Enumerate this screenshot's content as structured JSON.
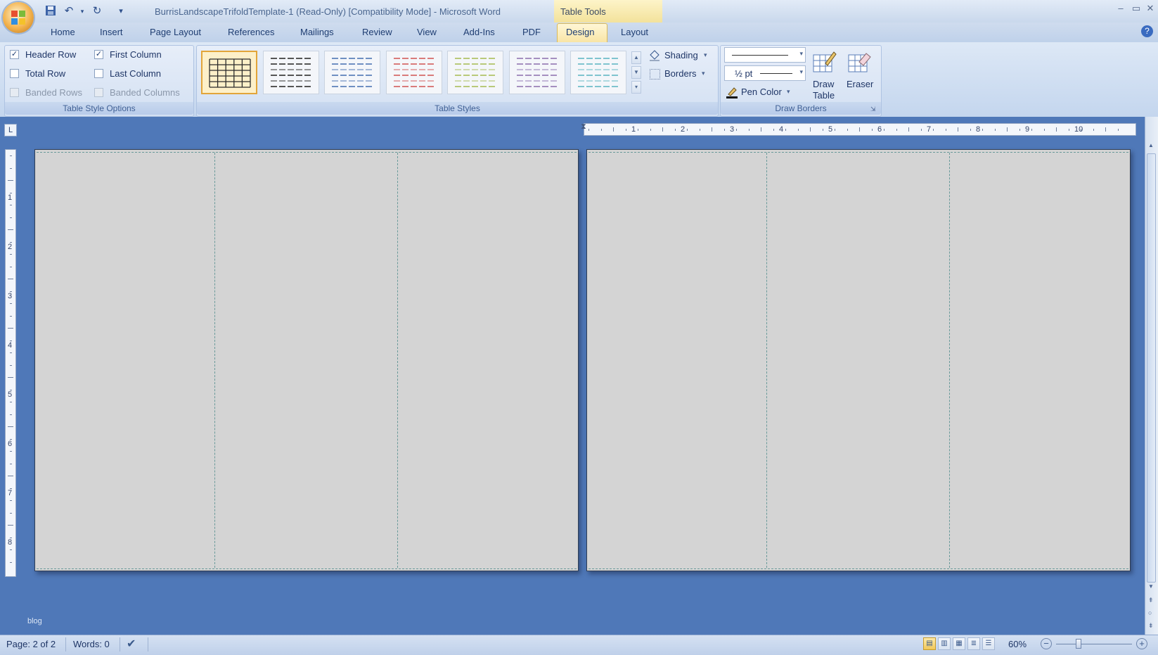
{
  "window": {
    "title": "BurrisLandscapeTrifoldTemplate-1 (Read-Only) [Compatibility Mode] - Microsoft Word",
    "contextual_tab": "Table Tools",
    "controls": [
      "–",
      "▭",
      "✕"
    ]
  },
  "tabs": [
    "Home",
    "Insert",
    "Page Layout",
    "References",
    "Mailings",
    "Review",
    "View",
    "Add-Ins",
    "PDF",
    "Design",
    "Layout"
  ],
  "active_tab": "Design",
  "ribbon": {
    "style_options": {
      "label": "Table Style Options",
      "header_row": {
        "label": "Header Row",
        "checked": true
      },
      "first_column": {
        "label": "First Column",
        "checked": true
      },
      "total_row": {
        "label": "Total Row",
        "checked": false
      },
      "last_column": {
        "label": "Last Column",
        "checked": false
      },
      "banded_rows": {
        "label": "Banded Rows",
        "checked": false
      },
      "banded_columns": {
        "label": "Banded Columns",
        "checked": false
      }
    },
    "table_styles": {
      "label": "Table Styles",
      "swatch_colors": [
        "#2b2b2b",
        "#555555",
        "#6f8fc2",
        "#d97b7b",
        "#b9c97a",
        "#a58fc0",
        "#7fc4cf"
      ],
      "shading": "Shading",
      "borders": "Borders"
    },
    "draw_borders": {
      "label": "Draw Borders",
      "line_weight": "½ pt",
      "pen_color": "Pen Color",
      "draw_table_line1": "Draw",
      "draw_table_line2": "Table",
      "eraser": "Eraser"
    }
  },
  "ruler": {
    "h_numbers": [
      "1",
      "2",
      "3",
      "4",
      "5",
      "6",
      "7",
      "8",
      "9",
      "10"
    ],
    "v_numbers": [
      "1",
      "2",
      "3",
      "4",
      "5",
      "6",
      "7",
      "8"
    ]
  },
  "watermark": "blog",
  "status": {
    "page": "Page: 2 of 2",
    "words": "Words: 0",
    "zoom": "60%"
  }
}
